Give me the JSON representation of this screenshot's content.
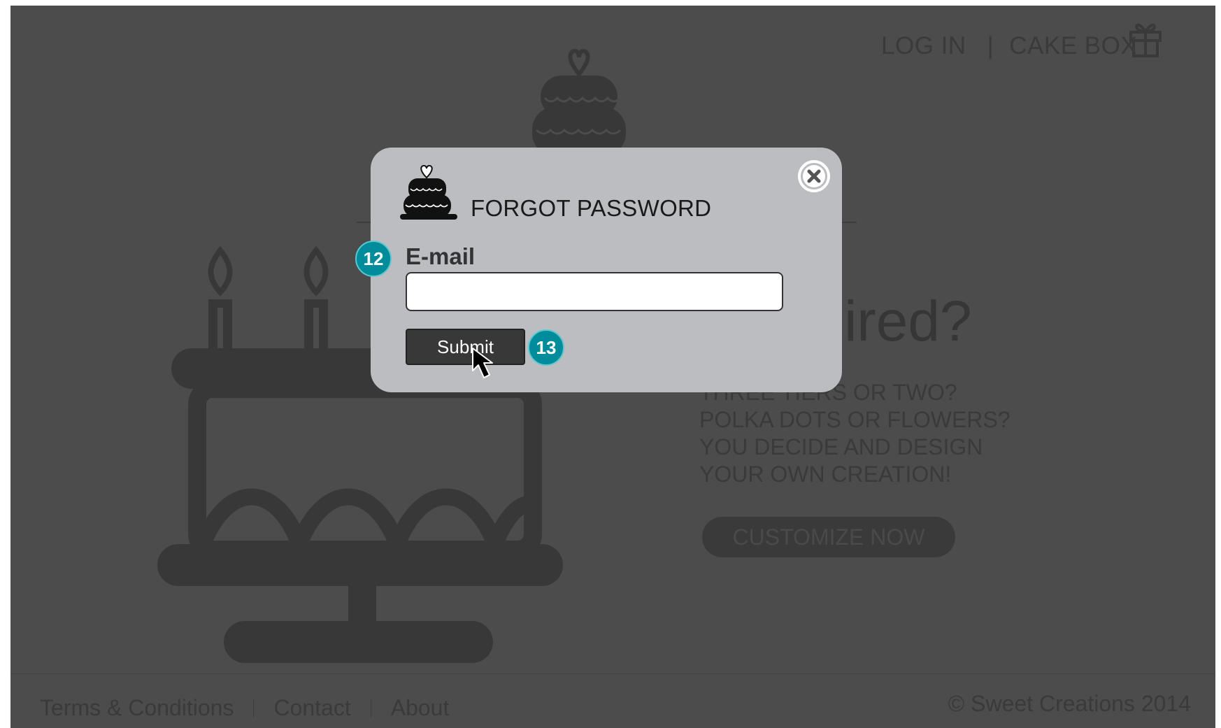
{
  "header": {
    "login_label": "LOG IN",
    "separator": "|",
    "cakebox_label": "CAKE BOX",
    "gift_icon": "gift-icon"
  },
  "hero": {
    "title_visible": "nspired?",
    "lines": [
      "THREE TIERS OR TWO?",
      "POLKA DOTS OR FLOWERS?",
      "YOU DECIDE AND DESIGN",
      "YOUR OWN CREATION!"
    ],
    "cta_label": "CUSTOMIZE NOW"
  },
  "footer": {
    "links": [
      "Terms & Conditions",
      "Contact",
      "About"
    ],
    "copyright": "© Sweet Creations 2014"
  },
  "modal": {
    "title": "FORGOT PASSWORD",
    "email_label": "E-mail",
    "email_value": "",
    "submit_label": "Submit",
    "close_icon": "close-icon",
    "logo_icon": "cake-icon"
  },
  "annotations": {
    "badge_email": "12",
    "badge_submit": "13"
  },
  "colors": {
    "overlay_bg": "#4c4c4c",
    "modal_bg": "#bcbdc0",
    "badge": "#008c9b",
    "button": "#383838"
  }
}
